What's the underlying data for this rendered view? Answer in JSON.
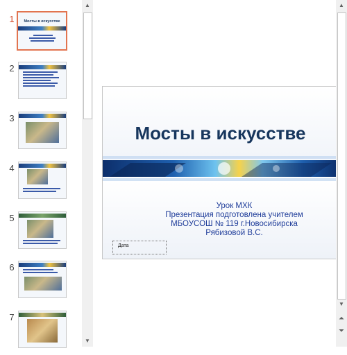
{
  "thumbnails": [
    {
      "number": "1",
      "title": "Мосты в искусстве"
    },
    {
      "number": "2"
    },
    {
      "number": "3"
    },
    {
      "number": "4"
    },
    {
      "number": "5"
    },
    {
      "number": "6"
    },
    {
      "number": "7"
    }
  ],
  "slide": {
    "title": "Мосты в искусстве",
    "subtitle_lines": [
      "Урок МХК",
      "Презентация подготовлена учителем",
      "МБОУСОШ № 119 г.Новосибирска",
      "Рябизовой В.С."
    ],
    "date_placeholder": "Дата"
  },
  "colors": {
    "accent": "#e2744f",
    "title": "#17365d",
    "subtitle": "#1f3d9a"
  },
  "icons": {
    "scroll_up": "up-arrow-icon",
    "scroll_down": "down-arrow-icon",
    "prev_slide": "double-up-arrow-icon",
    "next_slide": "double-down-arrow-icon"
  }
}
